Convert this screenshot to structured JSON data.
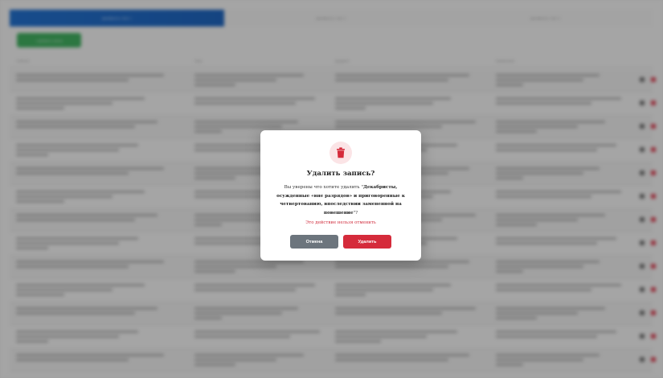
{
  "tabs": [
    {
      "label": "Декабристы. Лист 1"
    },
    {
      "label": "Декабристы. Лист 2"
    },
    {
      "label": "Декабристы. Лист 3"
    }
  ],
  "add_button": "+ Добавить запись",
  "table": {
    "headers": [
      "Событие",
      "Лицо",
      "Документ",
      "Примечание"
    ],
    "rows": 13
  },
  "modal": {
    "icon": "trash-icon",
    "title": "Удалить запись?",
    "message_prefix": "Вы уверены что хотите удалить \"",
    "record_name": "Декабристы, осужденные «вне разрядов» и приговоренные к четвертованию, впоследствии замененной на повешение",
    "message_suffix": "\"?",
    "warning": "Это действие нельзя отменить",
    "cancel_label": "Отмена",
    "delete_label": "Удалить"
  },
  "colors": {
    "active_tab": "#0e63c9",
    "add_button": "#2fa851",
    "delete_button": "#d52b3b",
    "cancel_button": "#6c757d",
    "warning_text": "#d12f3f"
  }
}
